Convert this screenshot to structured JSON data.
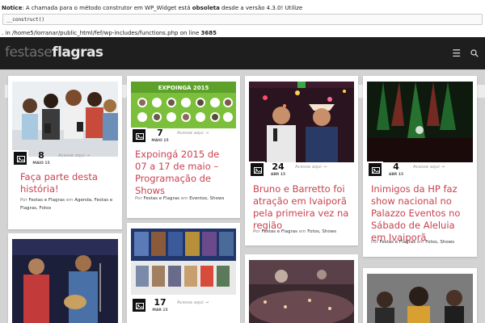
{
  "notice": {
    "label": "Notice",
    "text_a": ": A chamada para o método construtor em WP_Widget está ",
    "obsolete": "obsoleta",
    "text_b": " desde a versão 4.3.0! Utilize",
    "code": "__construct()",
    "path_text": ". in /home5/lorranar/public_html/fef/wp-includes/functions.php",
    "online": " on line ",
    "line_no": "3685"
  },
  "header": {
    "logo_light": "festase",
    "logo_bold": "flagras",
    "menu_icon": "menu-icon",
    "search_icon": "search-icon"
  },
  "posts": [
    {
      "day": "8",
      "month": "MAIO 15",
      "access": "Acesse aqui  →",
      "title": "Faça parte desta história!",
      "by": "Por",
      "author": "Festas e Flagras",
      "em": "em",
      "cats": "Agenda, Festas e Flagras, Fotos"
    },
    {
      "day": "7",
      "month": "MAIO 15",
      "access": "Acesse aqui  →",
      "title": "Expoingá 2015 de 07 a 17 de maio – Programação de Shows",
      "by": "Por",
      "author": "Festas e Flagras",
      "em": "em",
      "cats": "Eventos, Shows",
      "thumb_text": "EXPOINGÁ 2015"
    },
    {
      "day": "24",
      "month": "ABR 15",
      "access": "Acesse aqui  →",
      "title": "Bruno e Barretto foi atração em Ivaiporã pela primeira vez na região",
      "by": "Por",
      "author": "Festas e Flagras",
      "em": "em",
      "cats": "Fotos, Shows"
    },
    {
      "day": "4",
      "month": "ABR 15",
      "access": "Acesse aqui  →",
      "title": "Inimigos da HP faz show nacional no Palazzo Eventos no Sábado de Aleluia em Ivaiporã",
      "by": "Por",
      "author": "Festas e Flagras",
      "em": "em",
      "cats": "Fotos, Shows"
    },
    {
      "day": "17",
      "month": "MAR 15",
      "access": "Acesse aqui  →"
    }
  ],
  "colors": {
    "title": "#c9404f",
    "topbar": "#1e1e1e",
    "background": "#d3d3d3"
  }
}
